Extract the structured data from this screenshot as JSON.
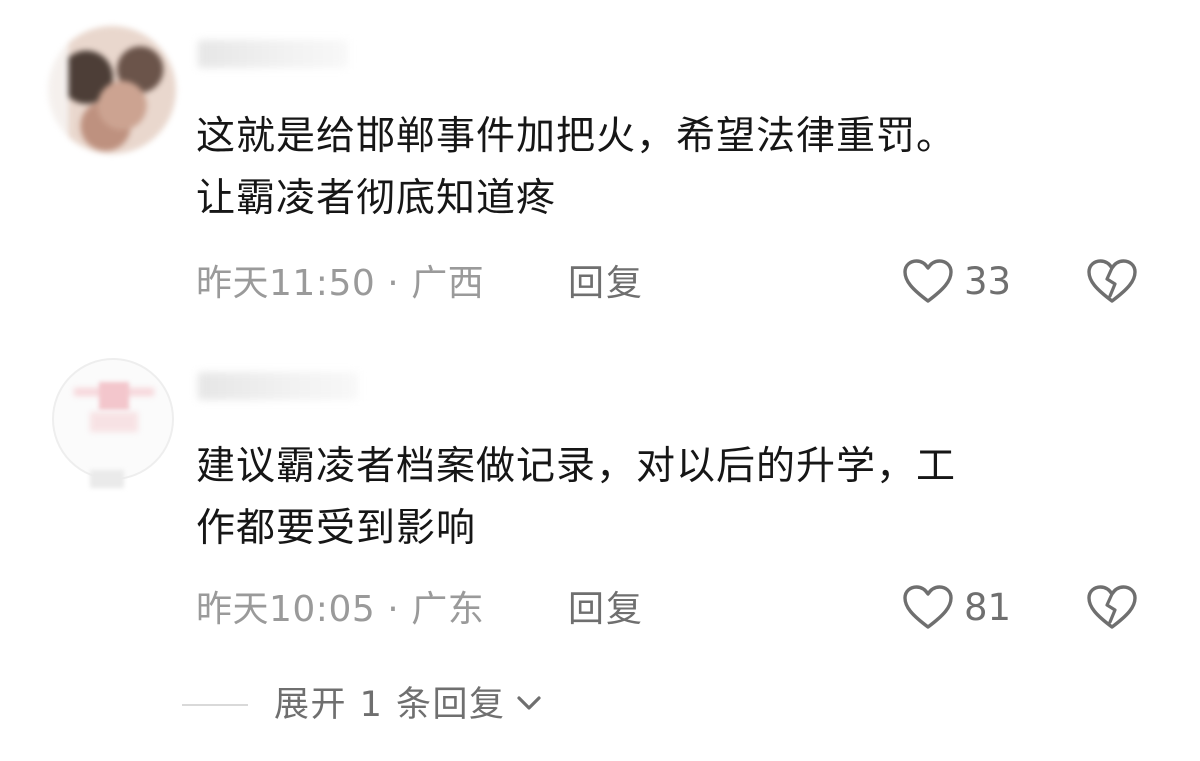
{
  "comments": [
    {
      "text_line1": "这就是给邯郸事件加把火，希望法律重罚。",
      "text_line2": "让霸凌者彻底知道疼",
      "time": "昨天11:50",
      "separator": "·",
      "location": "广西",
      "reply_label": "回复",
      "like_count": "33"
    },
    {
      "text_line1": "建议霸凌者档案做记录，对以后的升学，工",
      "text_line2": "作都要受到影响",
      "time": "昨天10:05",
      "separator": "·",
      "location": "广东",
      "reply_label": "回复",
      "like_count": "81"
    }
  ],
  "expand_replies_label": "展开 1 条回复",
  "icons": {
    "like": "heart-outline-icon",
    "dislike": "broken-heart-icon",
    "expand": "chevron-down-icon"
  },
  "colors": {
    "text": "#161616",
    "meta": "#9a9a9a",
    "action": "#6f6f6f"
  }
}
